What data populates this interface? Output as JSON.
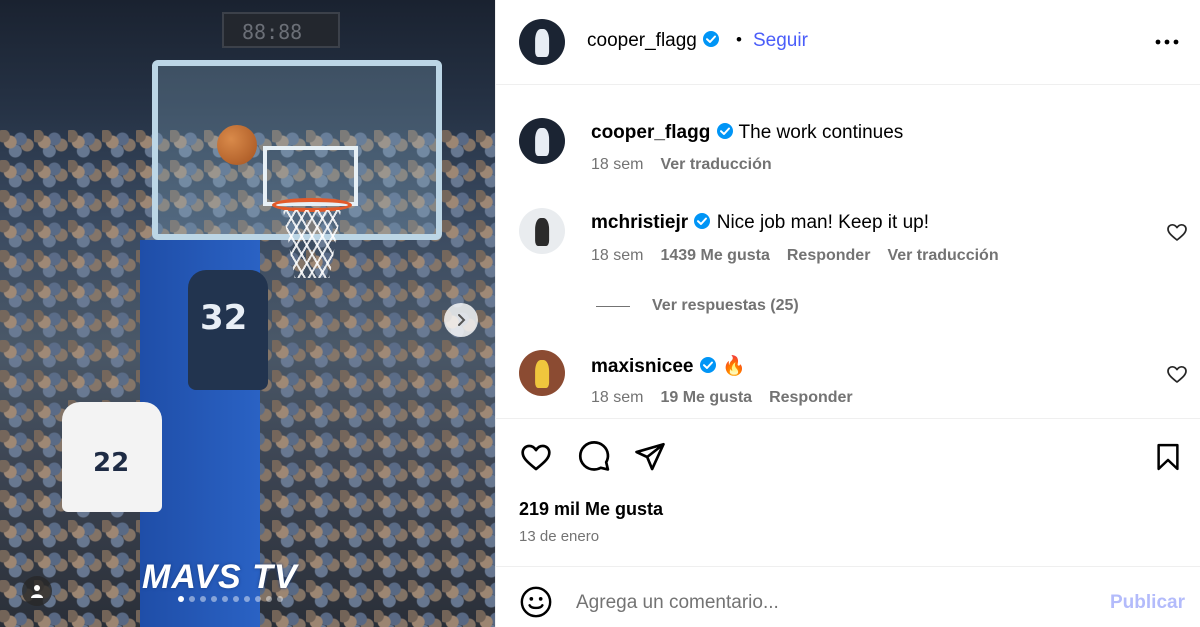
{
  "post": {
    "scoreboard": "88:88",
    "player1_number": "32",
    "player2_number": "22",
    "brand_text": "MAVS TV",
    "carousel_dots": 10,
    "carousel_active": 0
  },
  "header": {
    "username": "cooper_flagg",
    "separator": "•",
    "follow_label": "Seguir"
  },
  "caption": {
    "username": "cooper_flagg",
    "text": "The work continues",
    "time": "18 sem",
    "translate": "Ver traducción"
  },
  "comments": [
    {
      "username": "mchristiejr",
      "text": "Nice job man! Keep it up!",
      "time": "18 sem",
      "likes": "1439 Me gusta",
      "reply": "Responder",
      "translate": "Ver traducción"
    },
    {
      "username": "maxisnicee",
      "text": "🔥",
      "time": "18 sem",
      "likes": "19 Me gusta",
      "reply": "Responder"
    }
  ],
  "replies_link": "Ver respuestas (25)",
  "actions": {
    "likes_count": "219 mil Me gusta",
    "date": "13 de enero"
  },
  "composer": {
    "placeholder": "Agrega un comentario...",
    "publish_label": "Publicar"
  },
  "colors": {
    "accent": "#4a5df9",
    "muted": "#737373",
    "publish_disabled": "#b3bbfb",
    "verified": "#0095f6"
  }
}
